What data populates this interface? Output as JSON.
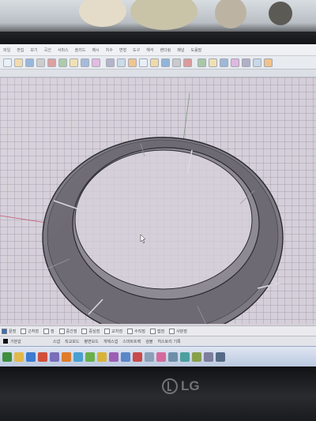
{
  "window": {
    "menu_items": [
      "파일",
      "편집",
      "보기",
      "곡선",
      "서피스",
      "솔리드",
      "메시",
      "치수",
      "변형",
      "도구",
      "해석",
      "렌더링",
      "패널",
      "도움말"
    ]
  },
  "toolbar": {
    "icons": [
      "new-file-icon",
      "open-icon",
      "save-icon",
      "print-icon",
      "cut-icon",
      "copy-icon",
      "paste-icon",
      "undo-icon",
      "redo-icon",
      "pan-icon",
      "rotate-icon",
      "zoom-icon",
      "zoom-window-icon",
      "zoom-extents-icon",
      "select-icon",
      "layer-icon",
      "properties-icon",
      "grid-icon",
      "render-icon",
      "material-icon",
      "light-icon",
      "osnap-icon",
      "options-icon",
      "help-icon"
    ]
  },
  "osnap": {
    "options": [
      {
        "label": "끝점",
        "checked": true
      },
      {
        "label": "근처점",
        "checked": false
      },
      {
        "label": "점",
        "checked": false
      },
      {
        "label": "중간점",
        "checked": false
      },
      {
        "label": "중심점",
        "checked": false
      },
      {
        "label": "교차점",
        "checked": false
      },
      {
        "label": "수직점",
        "checked": false
      },
      {
        "label": "접점",
        "checked": false
      },
      {
        "label": "사분점",
        "checked": false
      }
    ]
  },
  "statusbar": {
    "layer": "기본값",
    "items": [
      "스냅",
      "직교모드",
      "평면모드",
      "개체스냅",
      "스마트트랙",
      "검볼",
      "히스토리 기록"
    ]
  },
  "taskbar": {
    "icons": [
      "start-icon",
      "folder-icon",
      "ie-icon",
      "media-icon",
      "rhino-icon",
      "paint-icon",
      "chat-icon",
      "messenger-icon",
      "explorer-icon",
      "photo-icon",
      "settings-icon",
      "cad-icon",
      "notepad-icon",
      "music-icon",
      "calculator-icon",
      "camera-icon",
      "network-icon",
      "volume-icon",
      "clock-icon"
    ]
  },
  "monitor": {
    "brand": "LG"
  },
  "colors": {
    "ring_fill": "#7a7780",
    "ring_edge": "#2b2a2f",
    "ring_inner": "#b9b4bd",
    "axis_red": "#c0506a",
    "axis_green": "#7a9a7a"
  }
}
